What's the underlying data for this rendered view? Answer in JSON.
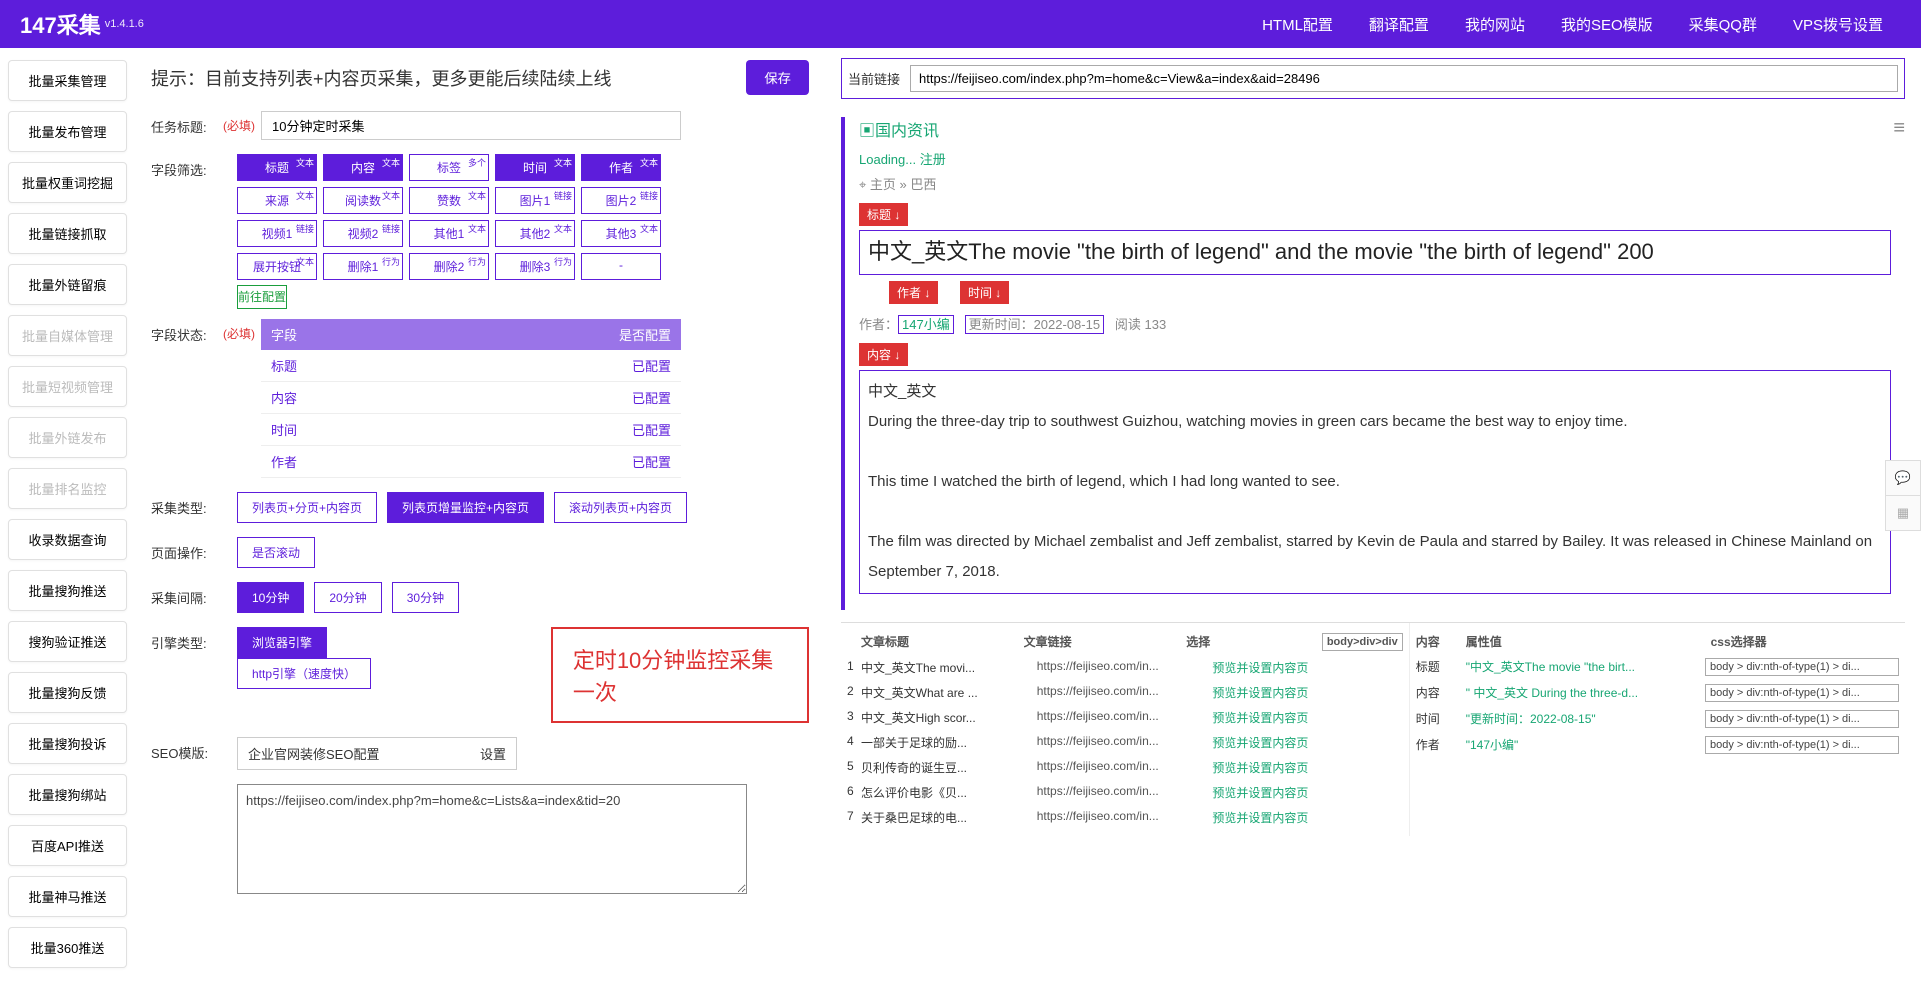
{
  "nav": {
    "brand": "147采集",
    "ver": "v1.4.1.6",
    "items": [
      "HTML配置",
      "翻译配置",
      "我的网站",
      "我的SEO模版",
      "采集QQ群",
      "VPS拨号设置"
    ]
  },
  "sidebar": [
    {
      "t": "批量采集管理",
      "d": 0
    },
    {
      "t": "批量发布管理",
      "d": 0
    },
    {
      "t": "批量权重词挖掘",
      "d": 0
    },
    {
      "t": "批量链接抓取",
      "d": 0
    },
    {
      "t": "批量外链留痕",
      "d": 0
    },
    {
      "t": "批量自媒体管理",
      "d": 1
    },
    {
      "t": "批量短视频管理",
      "d": 1
    },
    {
      "t": "批量外链发布",
      "d": 1
    },
    {
      "t": "批量排名监控",
      "d": 1
    },
    {
      "t": "收录数据查询",
      "d": 0
    },
    {
      "t": "批量搜狗推送",
      "d": 0
    },
    {
      "t": "搜狗验证推送",
      "d": 0
    },
    {
      "t": "批量搜狗反馈",
      "d": 0
    },
    {
      "t": "批量搜狗投诉",
      "d": 0
    },
    {
      "t": "批量搜狗绑站",
      "d": 0
    },
    {
      "t": "百度API推送",
      "d": 0
    },
    {
      "t": "批量神马推送",
      "d": 0
    },
    {
      "t": "批量360推送",
      "d": 0
    }
  ],
  "hint": "提示：目前支持列表+内容页采集，更多更能后续陆续上线",
  "save": "保存",
  "task": {
    "lbl": "任务标题:",
    "req": "(必填)",
    "val": "10分钟定时采集"
  },
  "filterLbl": "字段筛选:",
  "chips": [
    {
      "t": "标题",
      "s": "文本",
      "on": 1
    },
    {
      "t": "内容",
      "s": "文本",
      "on": 1
    },
    {
      "t": "标签",
      "s": "多个",
      "on": 0
    },
    {
      "t": "时间",
      "s": "文本",
      "on": 1
    },
    {
      "t": "作者",
      "s": "文本",
      "on": 1
    },
    {
      "t": "来源",
      "s": "文本",
      "on": 0
    },
    {
      "t": "阅读数",
      "s": "文本",
      "on": 0
    },
    {
      "t": "赞数",
      "s": "文本",
      "on": 0
    },
    {
      "t": "图片1",
      "s": "链接",
      "on": 0
    },
    {
      "t": "图片2",
      "s": "链接",
      "on": 0
    },
    {
      "t": "视频1",
      "s": "链接",
      "on": 0
    },
    {
      "t": "视频2",
      "s": "链接",
      "on": 0
    },
    {
      "t": "其他1",
      "s": "文本",
      "on": 0
    },
    {
      "t": "其他2",
      "s": "文本",
      "on": 0
    },
    {
      "t": "其他3",
      "s": "文本",
      "on": 0
    },
    {
      "t": "展开按钮",
      "s": "文本",
      "on": 0
    },
    {
      "t": "删除1",
      "s": "行为",
      "on": 0
    },
    {
      "t": "删除2",
      "s": "行为",
      "on": 0
    },
    {
      "t": "删除3",
      "s": "行为",
      "on": 0
    },
    {
      "t": "-",
      "s": "",
      "on": 0
    }
  ],
  "preCfg": "前往配置",
  "status": {
    "lbl": "字段状态:",
    "req": "(必填)",
    "h1": "字段",
    "h2": "是否配置",
    "rows": [
      [
        "标题",
        "已配置"
      ],
      [
        "内容",
        "已配置"
      ],
      [
        "时间",
        "已配置"
      ],
      [
        "作者",
        "已配置"
      ]
    ]
  },
  "ctype": {
    "lbl": "采集类型:",
    "opts": [
      "列表页+分页+内容页",
      "列表页增量监控+内容页",
      "滚动列表页+内容页"
    ],
    "sel": 1
  },
  "page": {
    "lbl": "页面操作:",
    "opt": "是否滚动"
  },
  "intv": {
    "lbl": "采集间隔:",
    "opts": [
      "10分钟",
      "20分钟",
      "30分钟"
    ],
    "sel": 0
  },
  "eng": {
    "lbl": "引擎类型:",
    "opts": [
      "浏览器引擎",
      "http引擎（速度快）"
    ],
    "sel": 0
  },
  "callout": "定时10分钟监控采集一次",
  "seo": {
    "lbl": "SEO模版:",
    "val": "企业官网装修SEO配置",
    "set": "设置"
  },
  "urls": "https://feijiseo.com/index.php?m=home&c=Lists&a=index&tid=20",
  "urlbar": {
    "lbl": "当前链接",
    "val": "https://feijiseo.com/index.php?m=home&c=View&a=index&aid=28496"
  },
  "pv": {
    "logo": "▣国内资讯",
    "load": "Loading... 注册",
    "crumb": "⌖ 主页 » 巴西",
    "tags": {
      "title": "标题 ↓",
      "author": "作者 ↓",
      "time": "时间 ↓",
      "content": "内容 ↓"
    },
    "title": "中文_英文The movie \"the birth of legend\" and the movie \"the birth of legend\" 200",
    "authorLbl": "作者：",
    "author": "147小编",
    "timeLbl": "更新时间：",
    "time": "2022-08-15",
    "read": "阅读 133",
    "bodyPre": "中文_英文",
    "body": "During the three-day trip to southwest Guizhou, watching movies in green cars became the best way to enjoy time.\n\nThis time I watched the birth of legend, which I had long wanted to see.\n\nThe film was directed by Michael zembalist and Jeff zembalist, starred by Kevin de Paula and starred by Bailey. It was released in Chinese Mainland on September 7, 2018."
  },
  "bl": {
    "h": [
      "文章标题",
      "文章链接",
      "选择"
    ],
    "selbox": "body>div>div",
    "rows": [
      [
        "1",
        "中文_英文The movi...",
        "https://feijiseo.com/in...",
        "预览并设置内容页"
      ],
      [
        "2",
        "中文_英文What are ...",
        "https://feijiseo.com/in...",
        "预览并设置内容页"
      ],
      [
        "3",
        "中文_英文High scor...",
        "https://feijiseo.com/in...",
        "预览并设置内容页"
      ],
      [
        "4",
        "一部关于足球的励...",
        "https://feijiseo.com/in...",
        "预览并设置内容页"
      ],
      [
        "5",
        "贝利传奇的诞生豆...",
        "https://feijiseo.com/in...",
        "预览并设置内容页"
      ],
      [
        "6",
        "怎么评价电影《贝...",
        "https://feijiseo.com/in...",
        "预览并设置内容页"
      ],
      [
        "7",
        "关于桑巴足球的电...",
        "https://feijiseo.com/in...",
        "预览并设置内容页"
      ]
    ]
  },
  "br": {
    "h": [
      "内容",
      "属性值",
      "css选择器"
    ],
    "rows": [
      [
        "标题",
        "\"中文_英文The movie \"the birt...",
        "body > div:nth-of-type(1) > di..."
      ],
      [
        "内容",
        "\" 中文_英文 During the three-d...",
        "body > div:nth-of-type(1) > di..."
      ],
      [
        "时间",
        "\"更新时间：2022-08-15\"",
        "body > div:nth-of-type(1) > di..."
      ],
      [
        "作者",
        "\"147小编\"",
        "body > div:nth-of-type(1) > di..."
      ]
    ]
  }
}
